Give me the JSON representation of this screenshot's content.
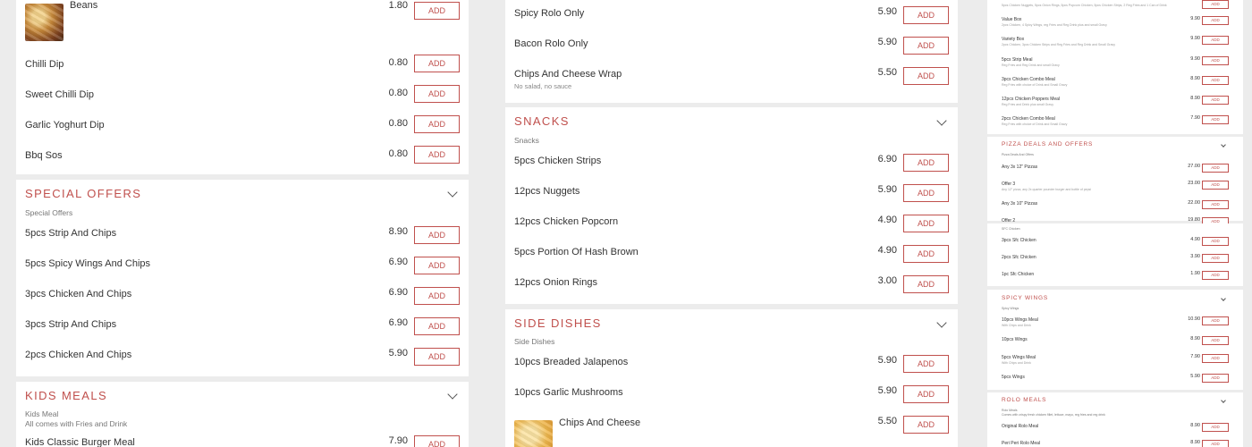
{
  "accent_color": "#c0504d",
  "col1": {
    "items_top": [
      {
        "name": "Beans",
        "price": "1.80",
        "add": "Add",
        "img": "food-thumbnail"
      },
      {
        "name": "Chilli Dip",
        "price": "0.80",
        "add": "Add"
      },
      {
        "name": "Sweet Chilli Dip",
        "price": "0.80",
        "add": "Add"
      },
      {
        "name": "Garlic Yoghurt Dip",
        "price": "0.80",
        "add": "Add"
      },
      {
        "name": "Bbq Sos",
        "price": "0.80",
        "add": "Add"
      }
    ],
    "special": {
      "title": "Special Offers",
      "subtitle": "Special Offers",
      "items": [
        {
          "name": "5pcs Strip And Chips",
          "price": "8.90",
          "add": "Add"
        },
        {
          "name": "5pcs Spicy Wings And Chips",
          "price": "6.90",
          "add": "Add"
        },
        {
          "name": "3pcs Chicken And Chips",
          "price": "6.90",
          "add": "Add"
        },
        {
          "name": "3pcs Strip And Chips",
          "price": "6.90",
          "add": "Add"
        },
        {
          "name": "2pcs Chicken And Chips",
          "price": "5.90",
          "add": "Add"
        }
      ]
    },
    "kids": {
      "title": "Kids Meals",
      "subtitle1": "Kids Meal",
      "subtitle2": "All comes with Fries and Drink",
      "items": [
        {
          "name": "Kids Classic Burger Meal",
          "price": "7.90",
          "add": "Add"
        }
      ]
    }
  },
  "col2": {
    "items_top": [
      {
        "name": "Spicy Rolo Only",
        "price": "5.90",
        "add": "Add"
      },
      {
        "name": "Bacon Rolo Only",
        "price": "5.90",
        "add": "Add"
      },
      {
        "name": "Chips And Cheese Wrap",
        "desc": "No salad, no sauce",
        "price": "5.50",
        "add": "Add"
      }
    ],
    "snacks": {
      "title": "Snacks",
      "subtitle": "Snacks",
      "items": [
        {
          "name": "5pcs Chicken Strips",
          "price": "6.90",
          "add": "Add"
        },
        {
          "name": "12pcs Nuggets",
          "price": "5.90",
          "add": "Add"
        },
        {
          "name": "12pcs Chicken Popcorn",
          "price": "4.90",
          "add": "Add"
        },
        {
          "name": "5pcs Portion Of Hash Brown",
          "price": "4.90",
          "add": "Add"
        },
        {
          "name": "12pcs Onion Rings",
          "price": "3.00",
          "add": "Add"
        }
      ]
    },
    "sides": {
      "title": "Side Dishes",
      "subtitle": "Side Dishes",
      "items": [
        {
          "name": "10pcs Breaded Jalapenos",
          "price": "5.90",
          "add": "Add"
        },
        {
          "name": "10pcs Garlic Mushrooms",
          "price": "5.90",
          "add": "Add"
        },
        {
          "name": "Chips And Cheese",
          "price": "5.50",
          "add": "Add",
          "img": "food-thumbnail"
        }
      ]
    }
  },
  "col3": {
    "top_rows": [
      {
        "name": "",
        "desc": "5pcs Chicken Nuggets, 5pcs Onion Rings, 5pcs Popcorn Chicken, 5pcs Chicken Strips, 2 Reg Fries and 1 Can of Drink",
        "price": "",
        "add": "Add"
      },
      {
        "name": "Value Box",
        "desc": "2pcs Chicken, 4 Spicy Wings, reg Fries and Reg Drink plus and small Gravy",
        "price": "9.90",
        "add": "Add"
      },
      {
        "name": "Variety Box",
        "desc": "2pcs Chicken, 3pcs Chicken Strips and Reg Fries and Reg Drink and Small Gravy",
        "price": "9.90",
        "add": "Add"
      },
      {
        "name": "5pcs Strip Meal",
        "desc": "Reg Fries and Reg Drink and small Gravy",
        "price": "9.90",
        "add": "Add"
      },
      {
        "name": "3pcs Chicken Combo Meal",
        "desc": "Reg Fries with choice of Drink and Small Gravy",
        "price": "8.90",
        "add": "Add"
      },
      {
        "name": "12pcs Chicken Poppers Meal",
        "desc": "Reg Fries and Drink plus small Gravy",
        "price": "8.90",
        "add": "Add"
      },
      {
        "name": "2pcs Chicken Combo Meal",
        "desc": "Reg Fries with choice of Drink and Small Gravy",
        "price": "7.90",
        "add": "Add"
      }
    ],
    "pizza": {
      "title": "Pizza Deals And Offers",
      "subtitle": "Pizza Deals And Offers",
      "items": [
        {
          "name": "Any 3x 12\" Pizzas",
          "desc": "",
          "price": "27.00",
          "add": "Add"
        },
        {
          "name": "Offer 3",
          "desc": "Any 12\" pizza, any 2x quarter pounder burger and bottle of pepsi",
          "price": "23.00",
          "add": "Add"
        },
        {
          "name": "Any 3x 10\" Pizzas",
          "desc": "",
          "price": "22.00",
          "add": "Add"
        },
        {
          "name": "Offer 2",
          "desc": "",
          "price": "19.80",
          "add": "Add"
        }
      ]
    },
    "sfc": {
      "subtitle": "SFC Chicken",
      "items": [
        {
          "name": "3pcs Sfc Chicken",
          "price": "4.90",
          "add": "Add"
        },
        {
          "name": "2pcs Sfc Chicken",
          "price": "3.90",
          "add": "Add"
        },
        {
          "name": "1pc Sfc Chicken",
          "price": "1.90",
          "add": "Add"
        }
      ]
    },
    "wings": {
      "title": "Spicy Wings",
      "subtitle": "Spicy Wings",
      "items": [
        {
          "name": "10pcs Wings Meal",
          "desc": "With Chips and Drink",
          "price": "10.90",
          "add": "Add"
        },
        {
          "name": "10pcs Wings",
          "desc": "",
          "price": "8.90",
          "add": "Add"
        },
        {
          "name": "5pcs Wings Meal",
          "desc": "With Chips and Drink",
          "price": "7.90",
          "add": "Add"
        },
        {
          "name": "5pcs Wings",
          "desc": "",
          "price": "5.90",
          "add": "Add"
        }
      ]
    },
    "rolo": {
      "title": "Rolo Meals",
      "subtitle1": "Rolo Meals",
      "subtitle2": "Comes with crispy fresh chicken fillet, lettuce, mayo, reg fries and reg drink",
      "items": [
        {
          "name": "Original Rolo Meal",
          "desc": "",
          "price": "8.90",
          "add": "Add"
        },
        {
          "name": "Peri Peri Rolo Meal",
          "desc": "",
          "price": "8.90",
          "add": "Add"
        }
      ]
    }
  }
}
